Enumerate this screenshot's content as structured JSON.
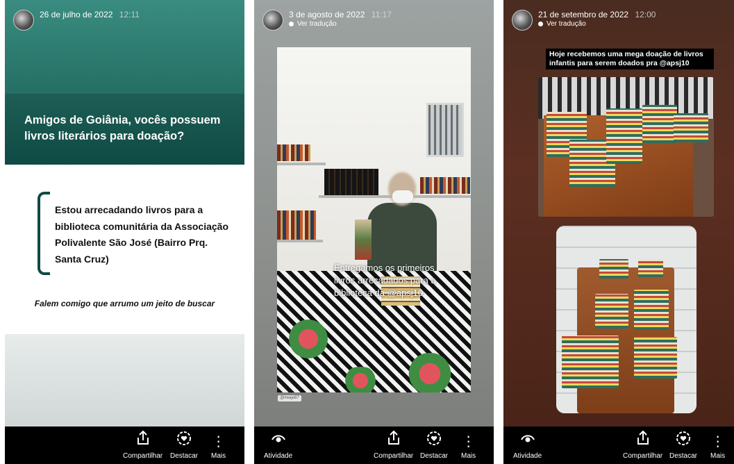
{
  "bottom_bar": {
    "activity_label": "Atividade",
    "share_label": "Compartilhar",
    "highlight_label": "Destacar",
    "more_label": "Mais"
  },
  "stories": [
    {
      "date": "26 de julho de 2022",
      "time": "12:11",
      "question": "Amigos de Goiânia, vocês possuem livros literários para doação?",
      "body": "Estou arrecadando livros para a biblioteca comunitária da Associação Polivalente São José (Bairro Prq. Santa Cruz)",
      "italic_line": "Falem comigo que arrumo um jeito de buscar"
    },
    {
      "date": "3 de agosto de 2022",
      "time": "11:17",
      "translation_link": "Ver tradução",
      "caption": "Entregamos os primeiros livros arrecadados para a biblioteca da @apsj10",
      "photo_tag": "@ireaje87"
    },
    {
      "date": "21 de setembro de 2022",
      "time": "12:00",
      "translation_link": "Ver tradução",
      "banner": "Hoje recebemos uma mega doação de livros infantis para serem doados pra @apsj10"
    }
  ],
  "icons": {
    "share": "share-icon",
    "highlight": "highlight-heart-icon",
    "more": "more-vertical-icon",
    "activity": "eye-icon"
  },
  "colors": {
    "teal_dark": "#0f4a44",
    "teal": "#256f65",
    "bar": "#000000"
  }
}
